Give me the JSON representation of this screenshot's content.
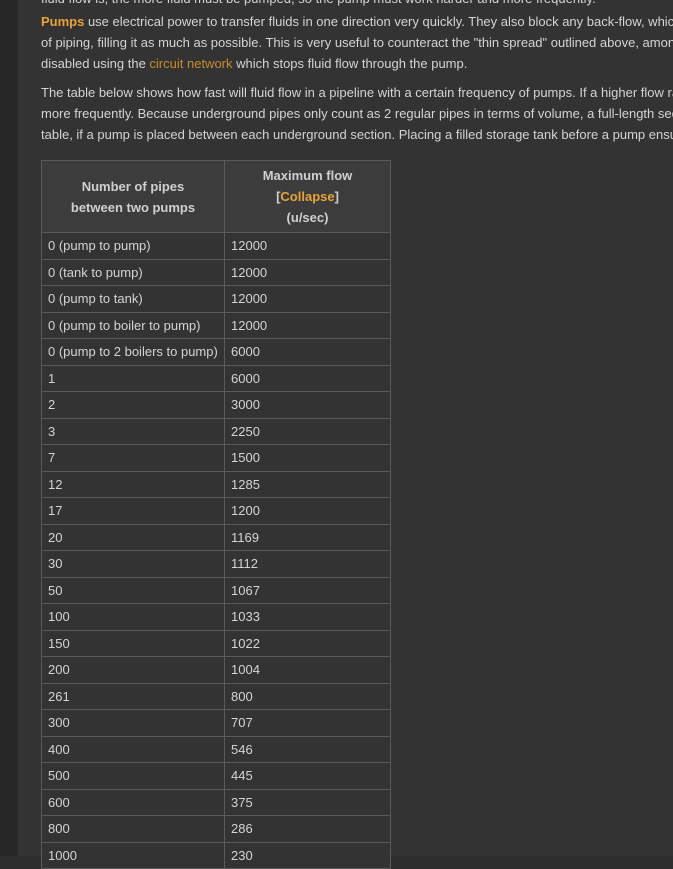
{
  "top_fragment": "fluid flow is, the more fluid must be pumped, so the pump must work harder and more frequently.",
  "para1": {
    "link_pumps": "Pumps",
    "line1_rest": " use electrical power to transfer fluids in one direction very quickly. They also block any back-flow, which",
    "line2": "of piping, filling it as much as possible. This is very useful to counteract the \"thin spread\" outlined above, among",
    "line3_pre": "disabled using the ",
    "link_circuit": "circuit network",
    "line3_post": " which stops fluid flow through the pump."
  },
  "para2": {
    "line1": "The table below shows how fast will fluid flow in a pipeline with a certain frequency of pumps. If a higher flow rate",
    "line2": "more frequently. Because underground pipes only count as 2 regular pipes in terms of volume, a full-length section",
    "line3": "table, if a pump is placed between each underground section. Placing a filled storage tank before a pump ensures"
  },
  "table": {
    "col1_line1": "Number of pipes",
    "col1_line2": "between two pumps",
    "col2_prefix": "Maximum flow [",
    "col2_collapse": "Collapse",
    "col2_suffix": "]",
    "col2_line2": "(u/sec)",
    "rows": [
      [
        "0 (pump to pump)",
        "12000"
      ],
      [
        "0 (tank to pump)",
        "12000"
      ],
      [
        "0 (pump to tank)",
        "12000"
      ],
      [
        "0 (pump to boiler to pump)",
        "12000"
      ],
      [
        "0 (pump to 2 boilers to pump)",
        "6000"
      ],
      [
        "1",
        "6000"
      ],
      [
        "2",
        "3000"
      ],
      [
        "3",
        "2250"
      ],
      [
        "7",
        "1500"
      ],
      [
        "12",
        "1285"
      ],
      [
        "17",
        "1200"
      ],
      [
        "20",
        "1169"
      ],
      [
        "30",
        "1112"
      ],
      [
        "50",
        "1067"
      ],
      [
        "100",
        "1033"
      ],
      [
        "150",
        "1022"
      ],
      [
        "200",
        "1004"
      ],
      [
        "261",
        "800"
      ],
      [
        "300",
        "707"
      ],
      [
        "400",
        "546"
      ],
      [
        "500",
        "445"
      ],
      [
        "600",
        "375"
      ],
      [
        "800",
        "286"
      ],
      [
        "1000",
        "230"
      ]
    ]
  }
}
